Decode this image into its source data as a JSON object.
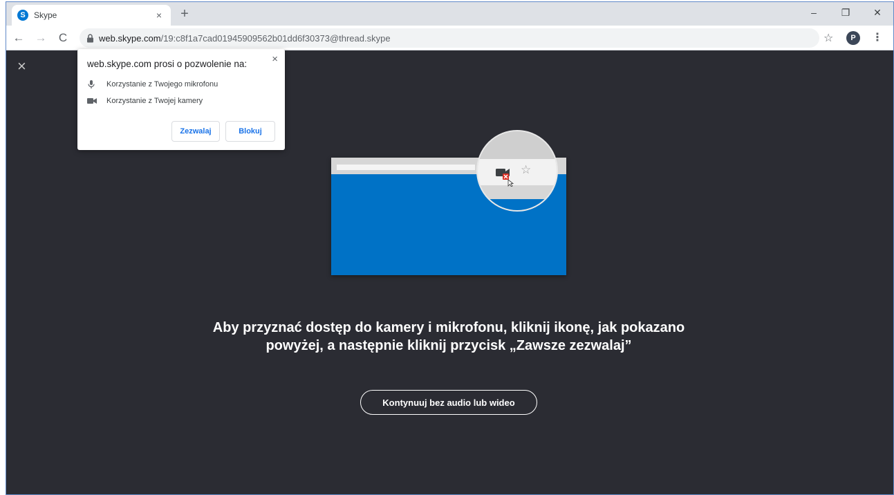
{
  "tab": {
    "favicon_letter": "S",
    "title": "Skype",
    "close": "×",
    "new_tab": "+"
  },
  "window_controls": {
    "minimize": "–",
    "restore": "❐",
    "close": "✕"
  },
  "toolbar": {
    "back": "←",
    "forward": "→",
    "reload": "C",
    "url_host": "web.skype.com",
    "url_path": "/19:c8f1a7cad01945909562b01dd6f30373@thread.skype",
    "star": "☆",
    "profile_initial": "P",
    "menu": "⋮"
  },
  "popup": {
    "title": "web.skype.com prosi o pozwolenie na:",
    "close": "×",
    "permissions": [
      {
        "icon": "microphone-icon",
        "label": "Korzystanie z Twojego mikrofonu"
      },
      {
        "icon": "camera-icon",
        "label": "Korzystanie z Twojej kamery"
      }
    ],
    "allow_label": "Zezwalaj",
    "block_label": "Blokuj"
  },
  "content": {
    "close": "×",
    "instruction": "Aby przyznać dostęp do kamery i mikrofonu, kliknij ikonę, jak pokazano powyżej, a następnie kliknij przycisk „Zawsze zezwalaj”",
    "continue_label": "Kontynuuj bez audio lub wideo"
  },
  "colors": {
    "background": "#2b2c33",
    "accent": "#0072c6",
    "link": "#1a73e8"
  }
}
